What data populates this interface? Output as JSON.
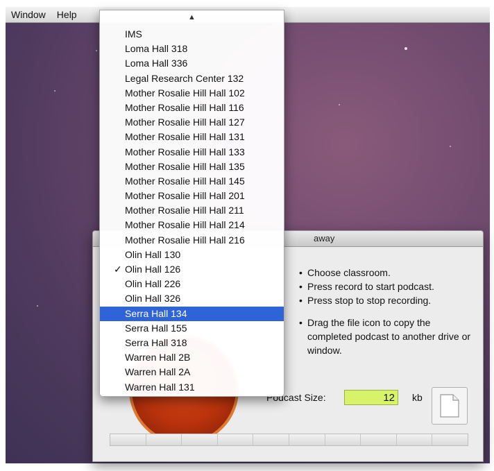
{
  "menubar": {
    "items": [
      "Window",
      "Help"
    ]
  },
  "window": {
    "title_fragment": "away",
    "instructions": [
      "Choose classroom.",
      "Press record to start podcast.",
      "Press stop to stop recording.",
      "Drag the file icon to copy the completed podcast to another drive or window."
    ],
    "size_label": "Podcast Size:",
    "size_value": "12",
    "size_unit": "kb"
  },
  "popup": {
    "scroll_up_icon": "triangle-up-icon",
    "checked_item": "Olin Hall 126",
    "highlighted_item": "Serra Hall 134",
    "items": [
      "IMS",
      "Loma Hall 318",
      "Loma Hall 336",
      "Legal Research Center 132",
      "Mother Rosalie Hill Hall 102",
      "Mother Rosalie Hill Hall 116",
      "Mother Rosalie Hill Hall 127",
      "Mother Rosalie Hill Hall 131",
      "Mother Rosalie Hill Hall 133",
      "Mother Rosalie Hill Hall 135",
      "Mother Rosalie Hill Hall 145",
      "Mother Rosalie Hill Hall 201",
      "Mother Rosalie Hill Hall 211",
      "Mother Rosalie Hill Hall 214",
      "Mother Rosalie Hill Hall 216",
      "Olin Hall 130",
      "Olin Hall 126",
      "Olin Hall 226",
      "Olin Hall 326",
      "Serra Hall 134",
      "Serra Hall 155",
      "Serra Hall 318",
      "Warren Hall 2B",
      "Warren Hall 2A",
      "Warren Hall 131"
    ]
  },
  "colors": {
    "highlight": "#2f63d8",
    "size_field": "#d8f36a",
    "record": "#b8320c"
  }
}
